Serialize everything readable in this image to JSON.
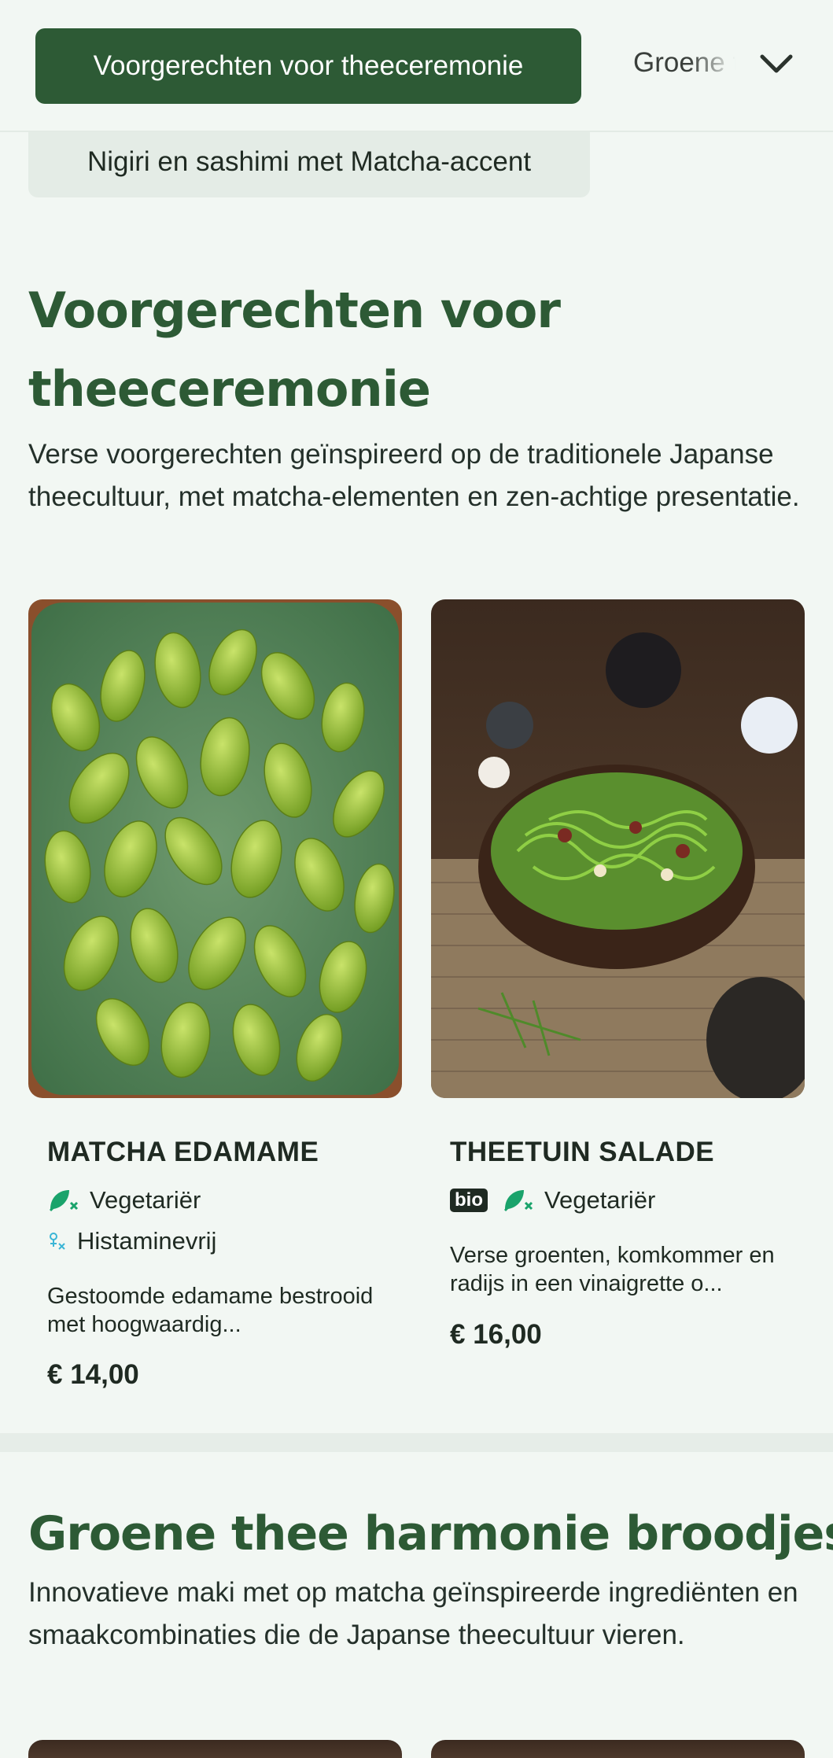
{
  "nav": {
    "active_category": "Voorgerechten voor theeceremonie",
    "next_category": "Groene thee harmonie broodjes",
    "previous_category": "Nigiri en sashimi met Matcha-accent"
  },
  "sections": [
    {
      "title": "Voorgerechten voor theeceremonie",
      "description": "Verse voorgerechten geïnspireerd op de traditionele Japanse theecultuur, met matcha-elementen en zen-achtige presentatie.",
      "dishes": [
        {
          "name": "MATCHA EDAMAME",
          "tags": [
            "Vegetariër",
            "Histaminevrij"
          ],
          "description": "Gestoomde edamame bestrooid met hoogwaardig...",
          "price": "€ 14,00"
        },
        {
          "name": "THEETUIN SALADE",
          "badge": "bio",
          "tags": [
            "Vegetariër"
          ],
          "description": "Verse groenten, komkommer en radijs in een vinaigrette o...",
          "price": "€ 16,00"
        }
      ]
    },
    {
      "title": "Groene thee harmonie broodjes",
      "description": "Innovatieve maki met op matcha geïnspireerde ingrediënten en smaakcombinaties die de Japanse theecultuur vieren."
    }
  ],
  "icons": {
    "dropdown": "chevron-down-icon",
    "vegetarian": "leaf-no-meat-icon",
    "histamine_free": "histamine-free-icon"
  },
  "colors": {
    "brand_green": "#2d5a35",
    "background": "#f2f7f3",
    "pill_background": "#e4ece6",
    "tag_green": "#1aa36b",
    "histamine_blue": "#3bb5d6"
  }
}
